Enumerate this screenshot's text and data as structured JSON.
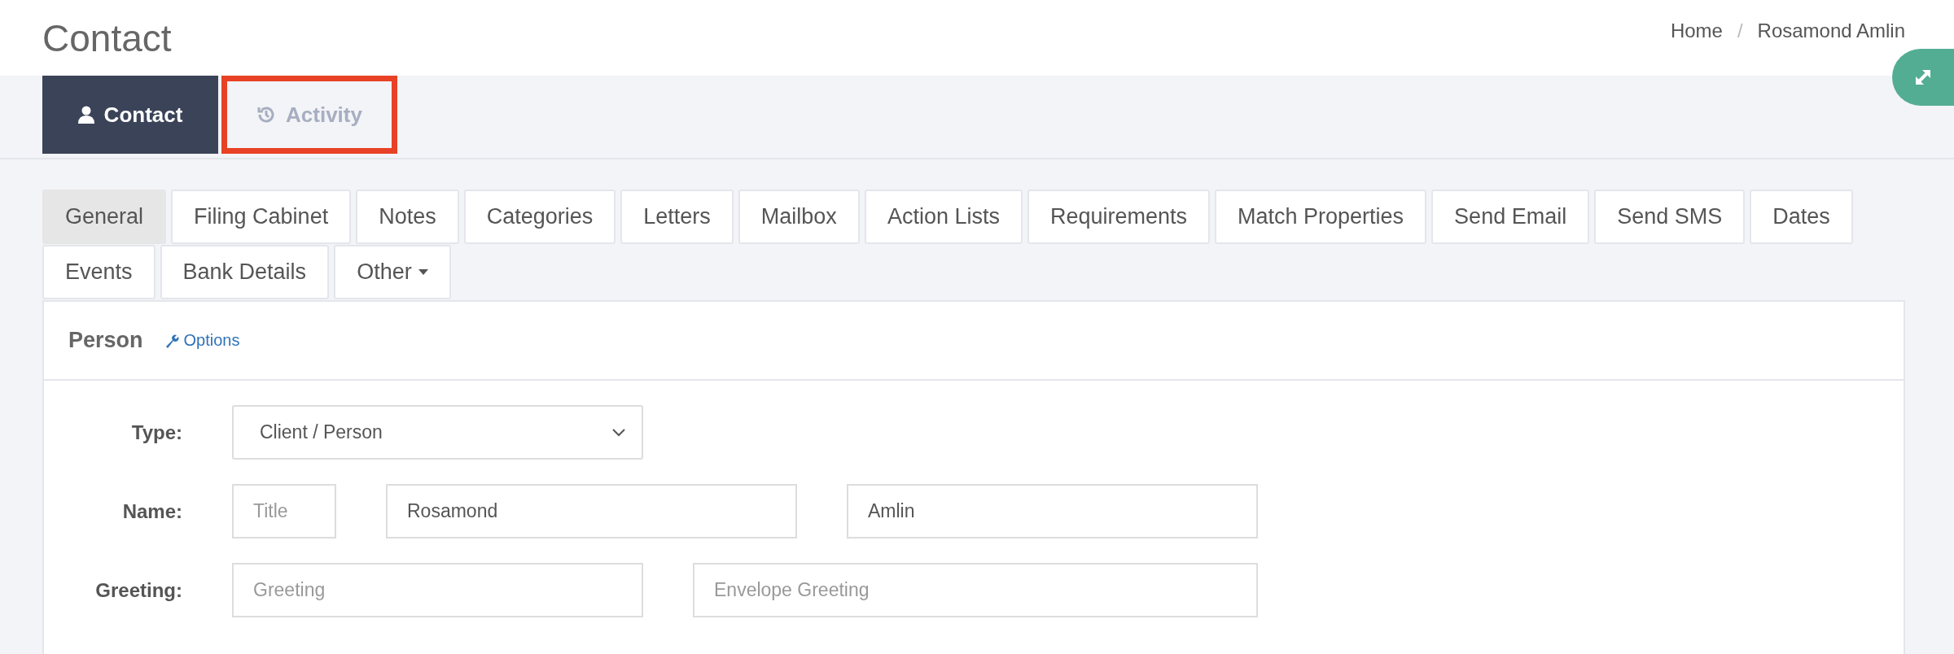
{
  "page_title": "Contact",
  "breadcrumb": {
    "items": [
      "Home",
      "Rosamond Amlin"
    ],
    "separator": "/"
  },
  "main_tabs": [
    {
      "label": "Contact",
      "selected": true,
      "highlighted": false
    },
    {
      "label": "Activity",
      "selected": false,
      "highlighted": true
    }
  ],
  "sub_tabs": [
    {
      "label": "General",
      "selected": true,
      "dropdown": false
    },
    {
      "label": "Filing Cabinet",
      "selected": false,
      "dropdown": false
    },
    {
      "label": "Notes",
      "selected": false,
      "dropdown": false
    },
    {
      "label": "Categories",
      "selected": false,
      "dropdown": false
    },
    {
      "label": "Letters",
      "selected": false,
      "dropdown": false
    },
    {
      "label": "Mailbox",
      "selected": false,
      "dropdown": false
    },
    {
      "label": "Action Lists",
      "selected": false,
      "dropdown": false
    },
    {
      "label": "Requirements",
      "selected": false,
      "dropdown": false
    },
    {
      "label": "Match Properties",
      "selected": false,
      "dropdown": false
    },
    {
      "label": "Send Email",
      "selected": false,
      "dropdown": false
    },
    {
      "label": "Send SMS",
      "selected": false,
      "dropdown": false
    },
    {
      "label": "Dates",
      "selected": false,
      "dropdown": false
    },
    {
      "label": "Events",
      "selected": false,
      "dropdown": false
    },
    {
      "label": "Bank Details",
      "selected": false,
      "dropdown": false
    },
    {
      "label": "Other",
      "selected": false,
      "dropdown": true
    }
  ],
  "panel": {
    "title": "Person",
    "options_link": "Options",
    "rows": [
      {
        "label": "Type:",
        "fields": [
          {
            "kind": "select",
            "value": "Client / Person"
          }
        ]
      },
      {
        "label": "Name:",
        "fields": [
          {
            "kind": "text",
            "placeholder": "Title"
          },
          {
            "kind": "text",
            "value": "Rosamond"
          },
          {
            "kind": "text",
            "value": "Amlin"
          }
        ]
      },
      {
        "label": "Greeting:",
        "fields": [
          {
            "kind": "text",
            "placeholder": "Greeting"
          },
          {
            "kind": "text",
            "placeholder": "Envelope Greeting"
          }
        ]
      }
    ]
  }
}
